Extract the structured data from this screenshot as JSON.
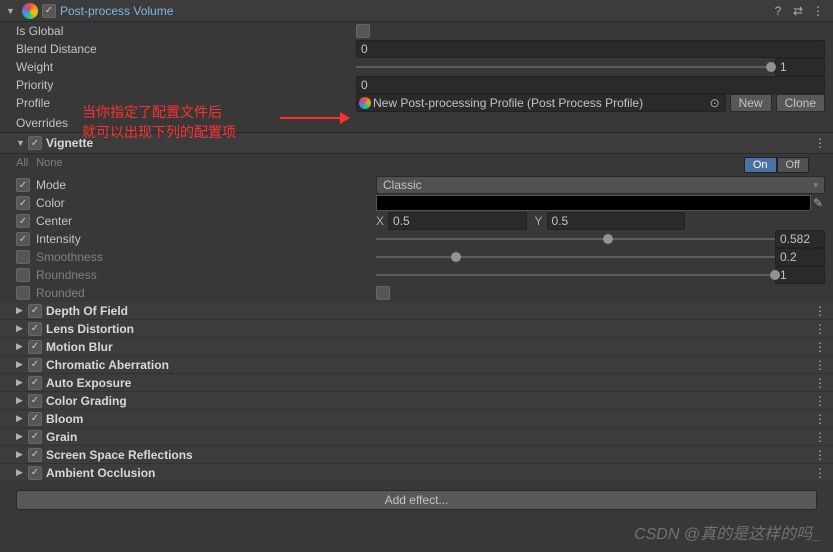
{
  "header": {
    "title": "Post-process Volume",
    "enabled": true
  },
  "props": {
    "isGlobal": {
      "label": "Is Global"
    },
    "blendDistance": {
      "label": "Blend Distance",
      "value": "0"
    },
    "weight": {
      "label": "Weight",
      "value": "1",
      "norm": 100
    },
    "priority": {
      "label": "Priority",
      "value": "0"
    },
    "profile": {
      "label": "Profile",
      "value": "New Post-processing Profile (Post Process Profile)",
      "new": "New",
      "clone": "Clone"
    }
  },
  "overrides": {
    "label": "Overrides"
  },
  "annotation": {
    "line1": "当你指定了配置文件后",
    "line2": "就可以出现下列的配置项"
  },
  "vignette": {
    "name": "Vignette",
    "all": "All",
    "none": "None",
    "on": "On",
    "off": "Off",
    "mode": {
      "label": "Mode",
      "value": "Classic"
    },
    "color": {
      "label": "Color"
    },
    "center": {
      "label": "Center",
      "xlbl": "X",
      "x": "0.5",
      "ylbl": "Y",
      "y": "0.5"
    },
    "intensity": {
      "label": "Intensity",
      "value": "0.582",
      "norm": 58.2
    },
    "smoothness": {
      "label": "Smoothness",
      "value": "0.2",
      "norm": 20
    },
    "roundness": {
      "label": "Roundness",
      "value": "1",
      "norm": 100
    },
    "rounded": {
      "label": "Rounded"
    }
  },
  "effects": [
    {
      "name": "Depth Of Field"
    },
    {
      "name": "Lens Distortion"
    },
    {
      "name": "Motion Blur"
    },
    {
      "name": "Chromatic Aberration"
    },
    {
      "name": "Auto Exposure"
    },
    {
      "name": "Color Grading"
    },
    {
      "name": "Bloom"
    },
    {
      "name": "Grain"
    },
    {
      "name": "Screen Space Reflections"
    },
    {
      "name": "Ambient Occlusion"
    }
  ],
  "addEffect": "Add effect...",
  "watermark": "CSDN @真的是这样的吗_"
}
